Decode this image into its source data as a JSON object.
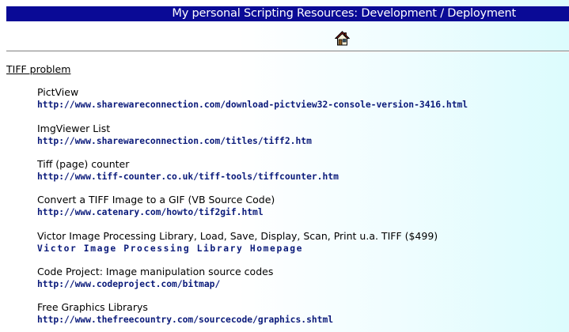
{
  "header": {
    "title": "My personal Scripting Resources: Development / Deployment",
    "home_icon": "home-icon"
  },
  "section": {
    "heading": "TIFF problem"
  },
  "colors": {
    "title_bar": "#0a0a96",
    "link": "#0a1a7a",
    "background_right": "#dcfcfd"
  },
  "entries": [
    {
      "title": "PictView",
      "link": "http://www.sharewareconnection.com/download-pictview32-console-version-3416.html"
    },
    {
      "title": "ImgViewer List",
      "link": "http://www.sharewareconnection.com/titles/tiff2.htm"
    },
    {
      "title": "Tiff (page) counter",
      "link": "http://www.tiff-counter.co.uk/tiff-tools/tiffcounter.htm"
    },
    {
      "title": "Convert a TIFF Image to a GIF (VB Source Code)",
      "link": "http://www.catenary.com/howto/tif2gif.html"
    },
    {
      "title": "Victor Image Processing Library, Load, Save, Display, Scan, Print u.a. TIFF ($499)",
      "link": "Victor Image Processing Library Homepage"
    },
    {
      "title": "Code Project: Image manipulation source codes",
      "link": "http://www.codeproject.com/bitmap/"
    },
    {
      "title": "Free Graphics Librarys",
      "link": "http://www.thefreecountry.com/sourcecode/graphics.shtml"
    }
  ]
}
